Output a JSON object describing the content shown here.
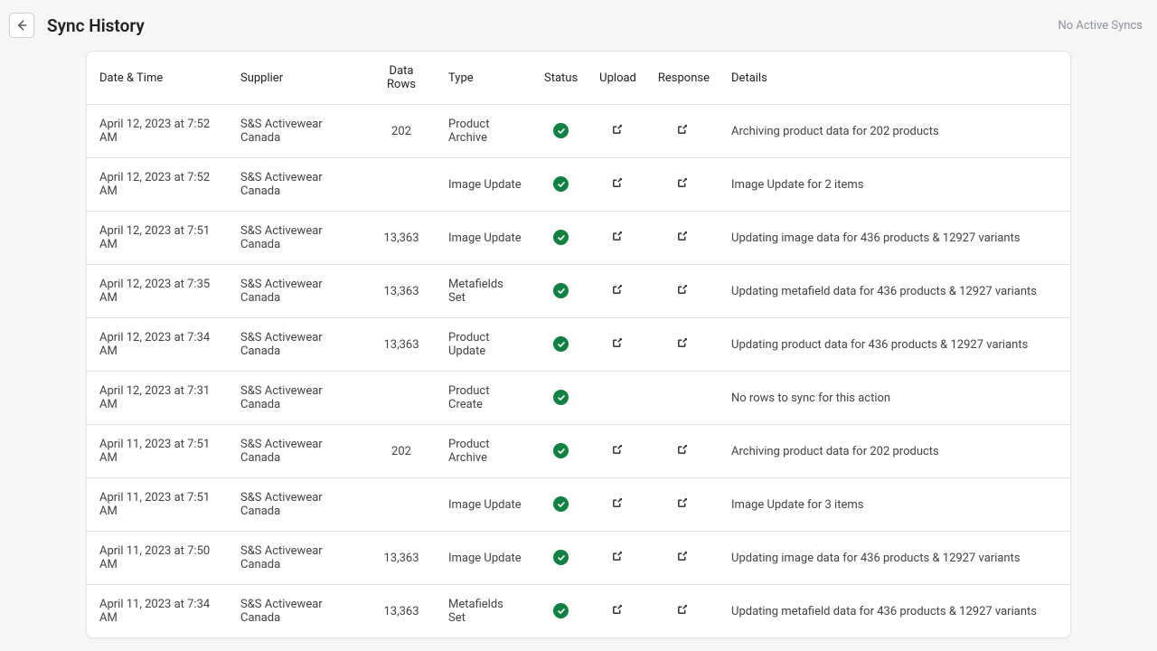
{
  "header": {
    "title": "Sync History",
    "no_active": "No Active Syncs"
  },
  "table": {
    "headers": {
      "datetime": "Date & Time",
      "supplier": "Supplier",
      "datarows": "Data Rows",
      "type": "Type",
      "status": "Status",
      "upload": "Upload",
      "response": "Response",
      "details": "Details"
    },
    "rows": [
      {
        "datetime": "April 12, 2023 at 7:52 AM",
        "supplier": "S&S Activewear Canada",
        "datarows": "202",
        "type": "Product Archive",
        "status": "success",
        "upload": true,
        "response": true,
        "details": "Archiving product data for 202 products"
      },
      {
        "datetime": "April 12, 2023 at 7:52 AM",
        "supplier": "S&S Activewear Canada",
        "datarows": "",
        "type": "Image Update",
        "status": "success",
        "upload": true,
        "response": true,
        "details": "Image Update for 2 items"
      },
      {
        "datetime": "April 12, 2023 at 7:51 AM",
        "supplier": "S&S Activewear Canada",
        "datarows": "13,363",
        "type": "Image Update",
        "status": "success",
        "upload": true,
        "response": true,
        "details": "Updating image data for 436 products & 12927 variants"
      },
      {
        "datetime": "April 12, 2023 at 7:35 AM",
        "supplier": "S&S Activewear Canada",
        "datarows": "13,363",
        "type": "Metafields Set",
        "status": "success",
        "upload": true,
        "response": true,
        "details": "Updating metafield data for 436 products & 12927 variants"
      },
      {
        "datetime": "April 12, 2023 at 7:34 AM",
        "supplier": "S&S Activewear Canada",
        "datarows": "13,363",
        "type": "Product Update",
        "status": "success",
        "upload": true,
        "response": true,
        "details": "Updating product data for 436 products & 12927 variants"
      },
      {
        "datetime": "April 12, 2023 at 7:31 AM",
        "supplier": "S&S Activewear Canada",
        "datarows": "",
        "type": "Product Create",
        "status": "success",
        "upload": false,
        "response": false,
        "details": "No rows to sync for this action"
      },
      {
        "datetime": "April 11, 2023 at 7:51 AM",
        "supplier": "S&S Activewear Canada",
        "datarows": "202",
        "type": "Product Archive",
        "status": "success",
        "upload": true,
        "response": true,
        "details": "Archiving product data for 202 products"
      },
      {
        "datetime": "April 11, 2023 at 7:51 AM",
        "supplier": "S&S Activewear Canada",
        "datarows": "",
        "type": "Image Update",
        "status": "success",
        "upload": true,
        "response": true,
        "details": "Image Update for 3 items"
      },
      {
        "datetime": "April 11, 2023 at 7:50 AM",
        "supplier": "S&S Activewear Canada",
        "datarows": "13,363",
        "type": "Image Update",
        "status": "success",
        "upload": true,
        "response": true,
        "details": "Updating image data for 436 products & 12927 variants"
      },
      {
        "datetime": "April 11, 2023 at 7:34 AM",
        "supplier": "S&S Activewear Canada",
        "datarows": "13,363",
        "type": "Metafields Set",
        "status": "success",
        "upload": true,
        "response": true,
        "details": "Updating metafield data for 436 products & 12927 variants"
      }
    ]
  }
}
